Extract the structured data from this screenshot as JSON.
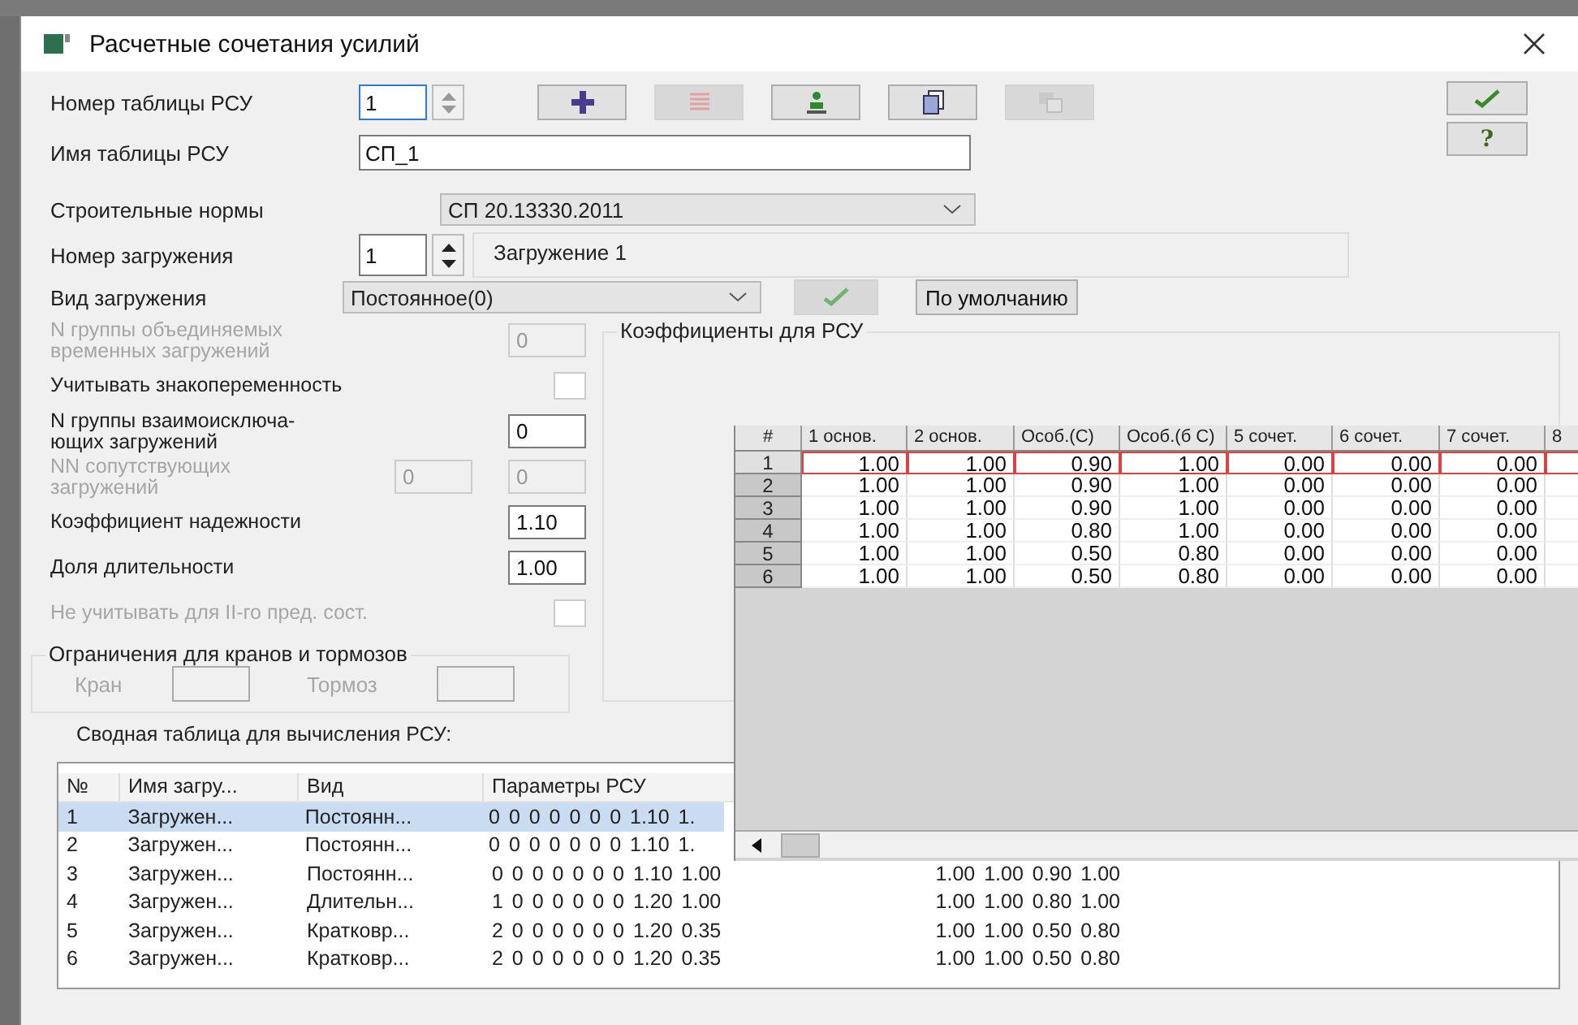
{
  "window": {
    "title": "Расчетные сочетания усилий"
  },
  "table_number": {
    "label": "Номер таблицы РСУ",
    "value": "1",
    "focused": true
  },
  "toolbar": [
    {
      "kind": "add",
      "disabled": false
    },
    {
      "kind": "delete",
      "disabled": true
    },
    {
      "kind": "figure",
      "disabled": false
    },
    {
      "kind": "copy",
      "disabled": false
    },
    {
      "kind": "paste",
      "disabled": true
    }
  ],
  "side_buttons": [
    {
      "kind": "ok"
    },
    {
      "kind": "help",
      "label": "?"
    }
  ],
  "table_name": {
    "label": "Имя таблицы РСУ",
    "value": "СП_1"
  },
  "norms": {
    "label": "Строительные нормы",
    "value": "СП 20.13330.2011"
  },
  "load_number": {
    "label": "Номер загружения",
    "value": "1",
    "name": "Загружение 1"
  },
  "load_type": {
    "label": "Вид загружения",
    "value": "Постоянное(0)",
    "apply_disabled": true,
    "default_button": "По умолчанию"
  },
  "params": [
    {
      "kind": "input",
      "label": "N группы объединяемых\nвременных загружений",
      "value": "0",
      "disabled": true
    },
    {
      "kind": "checkbox",
      "label": "Учитывать знакопеременность",
      "checked": false,
      "disabled": false
    },
    {
      "kind": "input",
      "label": "N группы взаимоисключа-\nющих загружений",
      "value": "0",
      "disabled": false
    },
    {
      "kind": "pair",
      "label": "NN сопутствующих\nзагружений",
      "values": [
        "0",
        "0"
      ],
      "disabled": true
    },
    {
      "kind": "input",
      "label": "Коэффициент надежности",
      "value": "1.10",
      "disabled": false
    },
    {
      "kind": "input",
      "label": "Доля длительности",
      "value": "1.00",
      "disabled": false
    },
    {
      "kind": "checkbox",
      "label": "Не учитывать для II-го пред. сост.",
      "checked": false,
      "disabled": true
    }
  ],
  "crane_limits": {
    "title": "Ограничения для кранов и тормозов",
    "crane_label": "Кран",
    "brake_label": "Тормоз",
    "disabled": true
  },
  "coefficients": {
    "title": "Коэффициенты для РСУ",
    "columns": [
      "#",
      "1 основ.",
      "2 основ.",
      "Особ.(С)",
      "Особ.(б С)",
      "5 сочет.",
      "6 сочет.",
      "7 сочет.",
      "8"
    ],
    "rows": [
      {
        "cells": [
          "1",
          "1.00",
          "1.00",
          "0.90",
          "1.00",
          "0.00",
          "0.00",
          "0.00"
        ],
        "selected": true
      },
      {
        "cells": [
          "2",
          "1.00",
          "1.00",
          "0.90",
          "1.00",
          "0.00",
          "0.00",
          "0.00"
        ],
        "selected": false
      },
      {
        "cells": [
          "3",
          "1.00",
          "1.00",
          "0.90",
          "1.00",
          "0.00",
          "0.00",
          "0.00"
        ],
        "selected": false
      },
      {
        "cells": [
          "4",
          "1.00",
          "1.00",
          "0.80",
          "1.00",
          "0.00",
          "0.00",
          "0.00"
        ],
        "selected": false
      },
      {
        "cells": [
          "5",
          "1.00",
          "1.00",
          "0.50",
          "0.80",
          "0.00",
          "0.00",
          "0.00"
        ],
        "selected": false
      },
      {
        "cells": [
          "6",
          "1.00",
          "1.00",
          "0.50",
          "0.80",
          "0.00",
          "0.00",
          "0.00"
        ],
        "selected": false
      }
    ]
  },
  "summary": {
    "title": "Сводная таблица для вычисления РСУ:",
    "columns": [
      "№",
      "Имя загру...",
      "Вид",
      "Параметры РСУ"
    ],
    "rows": [
      {
        "cells": [
          "1",
          "Загружен...",
          "Постоянн...",
          "0 0 0 0 0 0 0 1.10 1."
        ],
        "selected": true
      },
      {
        "cells": [
          "2",
          "Загружен...",
          "Постоянн...",
          "0 0 0 0 0 0 0 1.10 1."
        ],
        "selected": false
      },
      {
        "cells": [
          "3",
          "Загружен...",
          "Постоянн...",
          "0 0 0 0 0 0 0 1.10 1.00"
        ],
        "extra": "1.00 1.00 0.90 1.00",
        "selected": false
      },
      {
        "cells": [
          "4",
          "Загружен...",
          "Длительн...",
          "1 0 0 0 0 0 0 1.20 1.00"
        ],
        "extra": "1.00 1.00 0.80 1.00",
        "selected": false
      },
      {
        "cells": [
          "5",
          "Загружен...",
          "Кратковр...",
          "2 0 0 0 0 0 0 1.20 0.35"
        ],
        "extra": "1.00 1.00 0.50 0.80",
        "selected": false
      },
      {
        "cells": [
          "6",
          "Загружен...",
          "Кратковр...",
          "2 0 0 0 0 0 0 1.20 0.35"
        ],
        "extra": "1.00 1.00 0.50 0.80",
        "selected": false
      }
    ]
  }
}
